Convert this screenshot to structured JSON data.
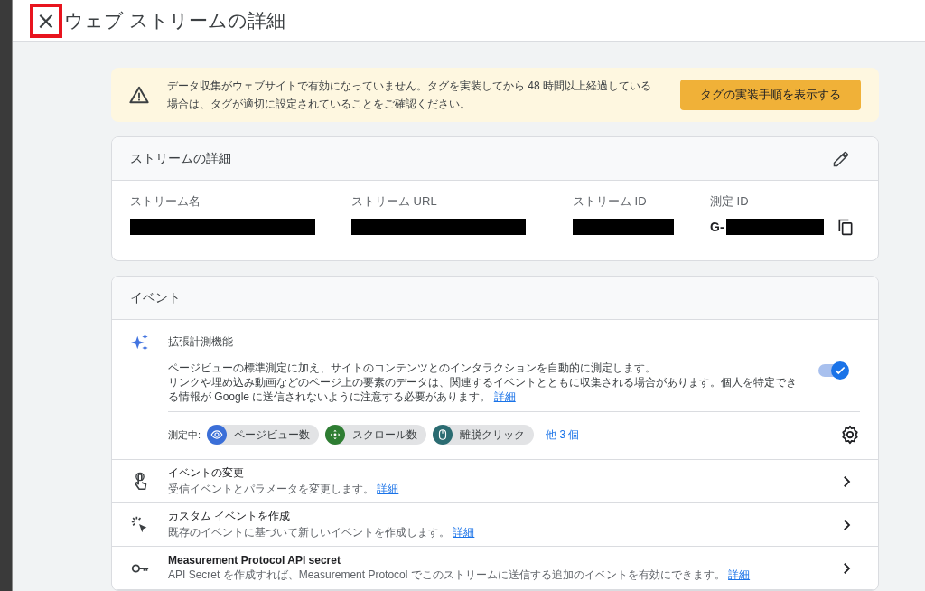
{
  "header": {
    "close_button": {
      "label": "×",
      "highlighted": true
    },
    "title": "ウェブ ストリームの詳細"
  },
  "alert": {
    "message": "データ収集がウェブサイトで有効になっていません。タグを実装してから 48 時間以上経過している場合は、タグが適切に設定されていることをご確認ください。",
    "button": "タグの実装手順を表示する"
  },
  "stream_details": {
    "title": "ストリームの詳細",
    "fields": [
      {
        "label": "ストリーム名",
        "redacted": true
      },
      {
        "label": "ストリーム URL",
        "redacted": true
      },
      {
        "label": "ストリーム ID",
        "redacted": true
      },
      {
        "label": "測定 ID",
        "prefix": "G-",
        "redacted": true,
        "copyable": true
      }
    ]
  },
  "events": {
    "title": "イベント",
    "enhanced": {
      "title": "拡張計測機能",
      "description": "ページビューの標準測定に加え、サイトのコンテンツとのインタラクションを自動的に測定します。",
      "description_2": "リンクや埋め込み動画などのページ上の要素のデータは、関連するイベントとともに収集される場合があります。個人を特定できる情報が Google に送信されないように注意する必要があります。",
      "link": "詳細",
      "toggle_on": true,
      "measuring_label": "測定中:",
      "chips": [
        {
          "label": "ページビュー数",
          "kind": "eye",
          "color": "#3b6fd8"
        },
        {
          "label": "スクロール数",
          "kind": "move",
          "color": "#2e7d32"
        },
        {
          "label": "離脱クリック",
          "kind": "mouse",
          "color": "#2b6c72"
        }
      ],
      "more": "他 3 個"
    },
    "rows": [
      {
        "kind": "touch",
        "title": "イベントの変更",
        "bold": false,
        "description": "受信イベントとパラメータを変更します。",
        "link": "詳細"
      },
      {
        "kind": "click",
        "title": "カスタム イベントを作成",
        "bold": false,
        "description": "既存のイベントに基づいて新しいイベントを作成します。",
        "link": "詳細"
      },
      {
        "kind": "key",
        "title": "Measurement Protocol API secret",
        "bold": true,
        "description": "API Secret を作成すれば、Measurement Protocol でこのストリームに送信する追加のイベントを有効にできます。",
        "link": "詳細"
      }
    ]
  }
}
